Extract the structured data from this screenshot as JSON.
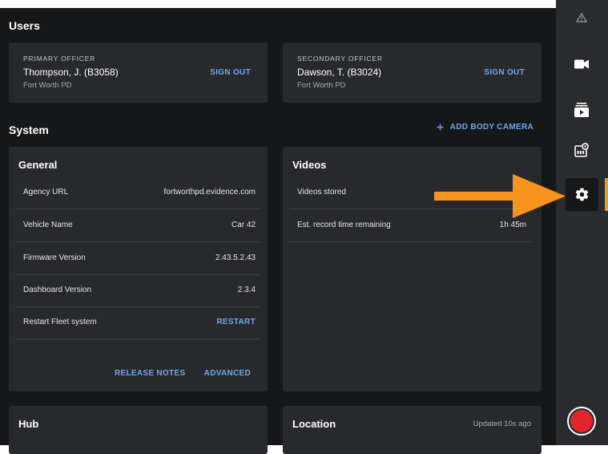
{
  "users": {
    "title": "Users",
    "primary": {
      "role": "PRIMARY OFFICER",
      "name": "Thompson, J. (B3058)",
      "dept": "Fort Worth PD",
      "action": "SIGN OUT"
    },
    "secondary": {
      "role": "SECONDARY OFFICER",
      "name": "Dawson, T. (B3024)",
      "dept": "Fort Worth PD",
      "action": "SIGN OUT"
    }
  },
  "system": {
    "title": "System",
    "add_camera": "ADD BODY CAMERA",
    "add_icon": "plus-icon"
  },
  "general": {
    "title": "General",
    "rows": [
      {
        "label": "Agency URL",
        "value": "fortworthpd.evidence.com"
      },
      {
        "label": "Vehicle  Name",
        "value": "Car 42"
      },
      {
        "label": "Firmware Version",
        "value": "2.43.5.2.43"
      },
      {
        "label": "Dashboard Version",
        "value": "2.3.4"
      },
      {
        "label": "Restart Fleet system",
        "value": "RESTART"
      }
    ],
    "release_notes": "RELEASE NOTES",
    "advanced": "ADVANCED"
  },
  "videos": {
    "title": "Videos",
    "rows": [
      {
        "label": "Videos stored",
        "value": ""
      },
      {
        "label": "Est. record time remaining",
        "value": "1h 45m"
      }
    ]
  },
  "hub": {
    "title": "Hub"
  },
  "location": {
    "title": "Location",
    "updated": "Updated 10s ago"
  },
  "rail": {
    "icons": [
      "warning-icon",
      "video-camera-icon",
      "video-library-icon",
      "camera-counter-icon",
      "settings-gear-icon",
      "record-button-icon"
    ],
    "active": "settings-gear-icon",
    "accent_color": "#f39c12",
    "record_color": "#e0262b"
  },
  "annotation": {
    "arrow_color": "#f7941d",
    "points_to": "settings-gear-icon"
  }
}
